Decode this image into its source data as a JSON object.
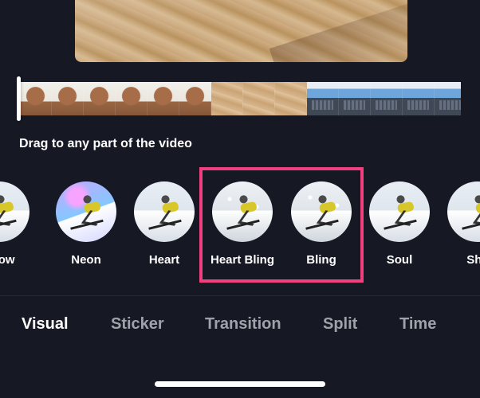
{
  "instruction": "Drag to any part of the video",
  "timeline": {
    "frames": [
      "statue",
      "statue",
      "statue",
      "statue",
      "statue",
      "statue",
      "wood",
      "wood",
      "wood",
      "laptop",
      "laptop",
      "laptop",
      "laptop",
      "laptop"
    ]
  },
  "effects": {
    "items": [
      {
        "label": "nbow"
      },
      {
        "label": "Neon"
      },
      {
        "label": "Heart"
      },
      {
        "label": "Heart Bling"
      },
      {
        "label": "Bling"
      },
      {
        "label": "Soul"
      },
      {
        "label": "Sha"
      }
    ]
  },
  "tabs": {
    "visual": "Visual",
    "sticker": "Sticker",
    "transition": "Transition",
    "split": "Split",
    "time": "Time"
  },
  "colors": {
    "background": "#161824",
    "selection": "#f23f7f",
    "text": "#ffffff",
    "inactive_tab": "#a0a2aa"
  },
  "icons": {
    "selection_highlight": "rectangle-highlight",
    "timeline_handle": "playhead-bar"
  }
}
